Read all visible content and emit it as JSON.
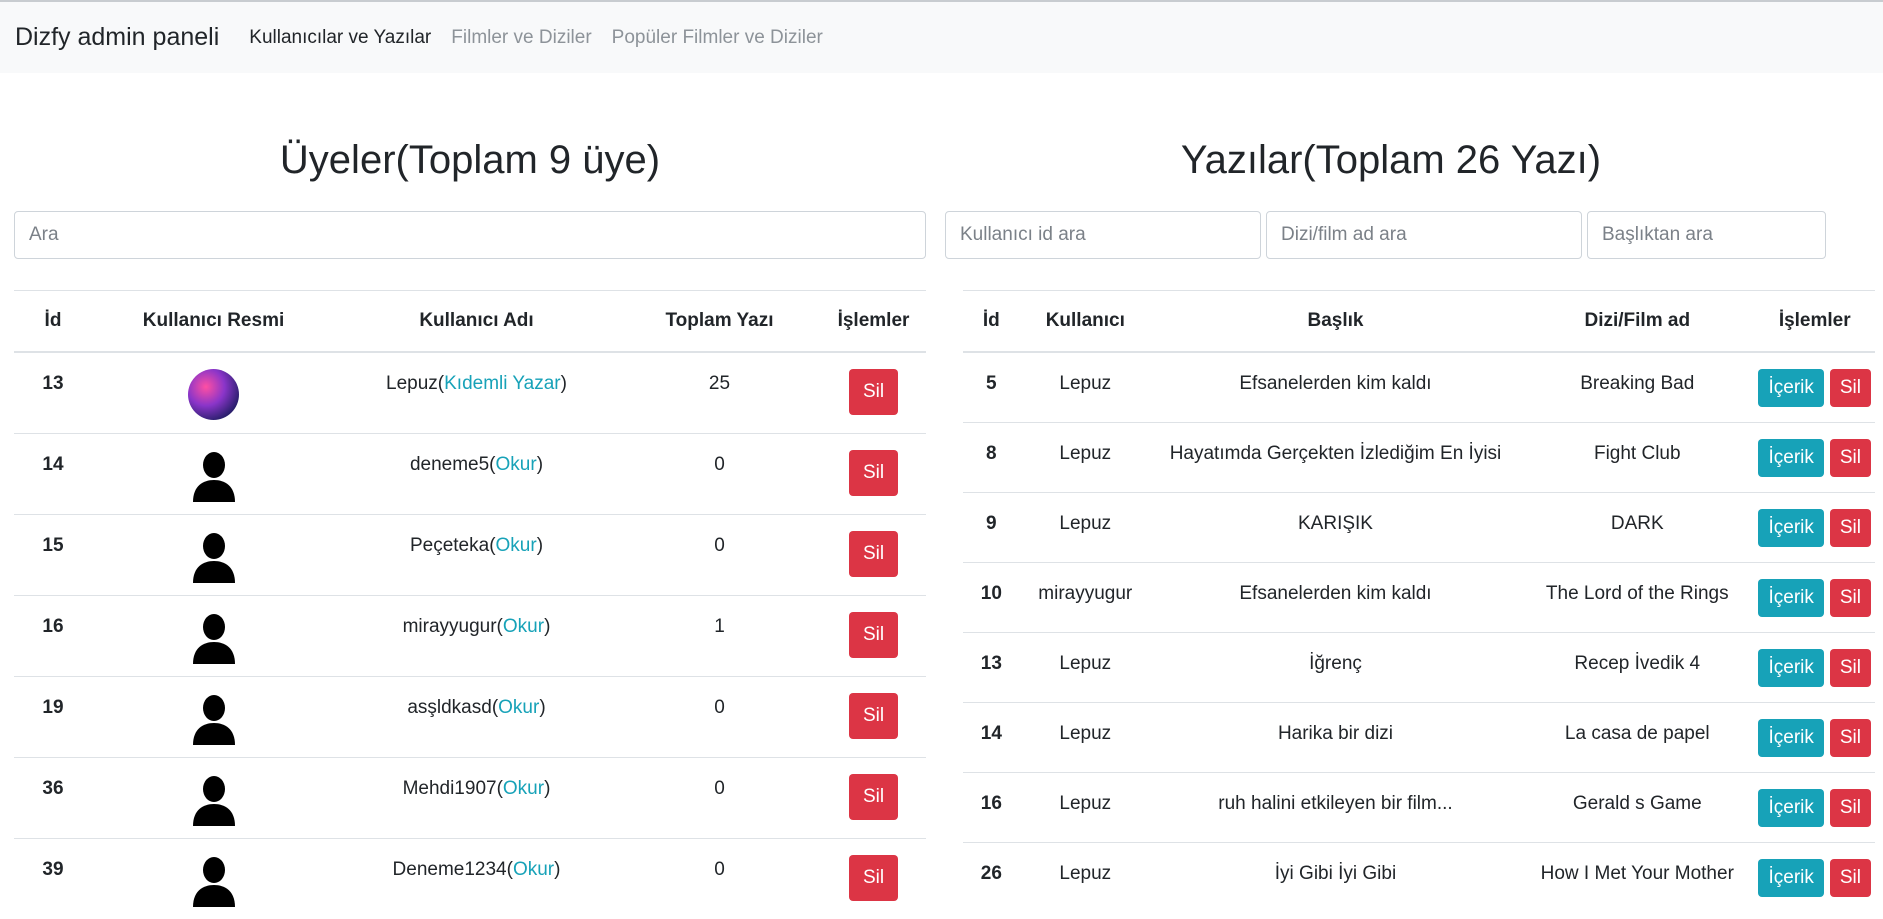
{
  "navbar": {
    "brand": "Dizfy admin paneli",
    "links": [
      {
        "label": "Kullanıcılar ve Yazılar"
      },
      {
        "label": "Filmler ve Diziler"
      },
      {
        "label": "Popüler Filmler ve Diziler"
      }
    ]
  },
  "members": {
    "title": "Üyeler(Toplam 9 üye)",
    "search_placeholder": "Ara",
    "columns": [
      "İd",
      "Kullanıcı Resmi",
      "Kullanıcı Adı",
      "Toplam Yazı",
      "İşlemler"
    ],
    "delete_label": "Sil",
    "rows": [
      {
        "id": "13",
        "name": "Lepuz(",
        "role": "Kıdemli Yazar",
        "close": ")",
        "posts": "25",
        "avatar": "photo"
      },
      {
        "id": "14",
        "name": "deneme5(",
        "role": "Okur",
        "close": ")",
        "posts": "0",
        "avatar": "silhouette"
      },
      {
        "id": "15",
        "name": "Peçeteka(",
        "role": "Okur",
        "close": ")",
        "posts": "0",
        "avatar": "silhouette"
      },
      {
        "id": "16",
        "name": "mirayyugur(",
        "role": "Okur",
        "close": ")",
        "posts": "1",
        "avatar": "silhouette"
      },
      {
        "id": "19",
        "name": "asşldkasd(",
        "role": "Okur",
        "close": ")",
        "posts": "0",
        "avatar": "silhouette"
      },
      {
        "id": "36",
        "name": "Mehdi1907(",
        "role": "Okur",
        "close": ")",
        "posts": "0",
        "avatar": "silhouette"
      },
      {
        "id": "39",
        "name": "Deneme1234(",
        "role": "Okur",
        "close": ")",
        "posts": "0",
        "avatar": "silhouette"
      }
    ]
  },
  "posts": {
    "title": "Yazılar(Toplam 26 Yazı)",
    "search": {
      "user_id_placeholder": "Kullanıcı id ara",
      "title_placeholder": "Dizi/film ad ara",
      "heading_placeholder": "Başlıktan ara"
    },
    "columns": [
      "İd",
      "Kullanıcı",
      "Başlık",
      "Dizi/Film ad",
      "İşlemler"
    ],
    "content_label": "İçerik",
    "delete_label": "Sil",
    "rows": [
      {
        "id": "5",
        "user": "Lepuz",
        "heading": "Efsanelerden kim kaldı",
        "film": "Breaking Bad"
      },
      {
        "id": "8",
        "user": "Lepuz",
        "heading": "Hayatımda Gerçekten İzlediğim En İyisi",
        "film": "Fight Club"
      },
      {
        "id": "9",
        "user": "Lepuz",
        "heading": "KARIŞIK",
        "film": "DARK"
      },
      {
        "id": "10",
        "user": "mirayyugur",
        "heading": "Efsanelerden kim kaldı",
        "film": "The Lord of the Rings"
      },
      {
        "id": "13",
        "user": "Lepuz",
        "heading": "İğrenç",
        "film": "Recep İvedik 4"
      },
      {
        "id": "14",
        "user": "Lepuz",
        "heading": "Harika bir dizi",
        "film": "La casa de papel"
      },
      {
        "id": "16",
        "user": "Lepuz",
        "heading": "ruh halini etkileyen bir film...",
        "film": "Gerald s Game"
      },
      {
        "id": "26",
        "user": "Lepuz",
        "heading": "İyi Gibi İyi Gibi",
        "film": "How I Met Your Mother"
      }
    ]
  },
  "colors": {
    "navbar_bg": "#f8f9fa",
    "danger": "#dc3545",
    "info": "#17a2b8"
  }
}
